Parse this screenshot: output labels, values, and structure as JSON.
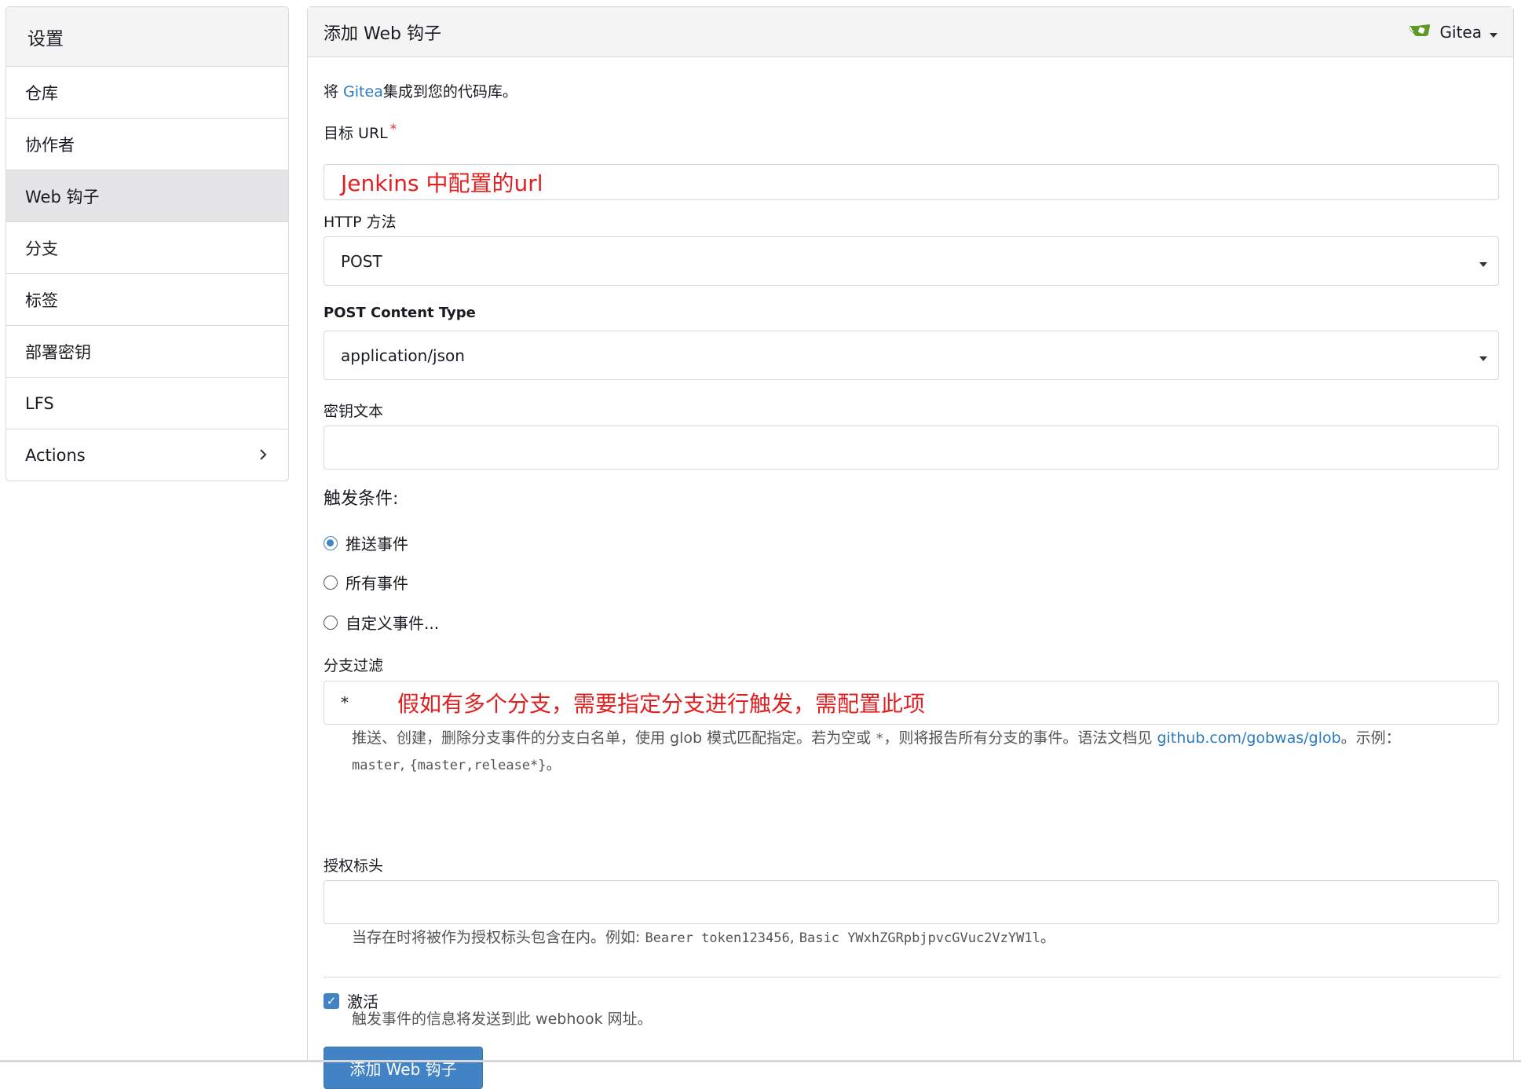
{
  "sidebar": {
    "header": "设置",
    "items": [
      {
        "label": "仓库"
      },
      {
        "label": "协作者"
      },
      {
        "label": "Web 钩子"
      },
      {
        "label": "分支"
      },
      {
        "label": "标签"
      },
      {
        "label": "部署密钥"
      },
      {
        "label": "LFS"
      },
      {
        "label": "Actions"
      }
    ],
    "active_item": "Web 钩子"
  },
  "panel": {
    "title": "添加 Web 钩子",
    "type_menu": {
      "label": "Gitea",
      "icon": "gitea-logo-icon"
    }
  },
  "intro": {
    "before": "将 ",
    "link": "Gitea",
    "after": "集成到您的代码库。"
  },
  "target_url": {
    "label": "目标 URL",
    "required_mark": "*",
    "value": "",
    "annotation": "Jenkins 中配置的url"
  },
  "http_method": {
    "label": "HTTP 方法",
    "value": "POST"
  },
  "content_type": {
    "label": "POST Content Type",
    "value": "application/json"
  },
  "secret": {
    "label": "密钥文本",
    "value": ""
  },
  "trigger": {
    "label": "触发条件:",
    "options": [
      {
        "label": "推送事件",
        "selected": true
      },
      {
        "label": "所有事件",
        "selected": false
      },
      {
        "label": "自定义事件...",
        "selected": false
      }
    ]
  },
  "branch_filter": {
    "label": "分支过滤",
    "value": "*",
    "annotation": "假如有多个分支，需要指定分支进行触发，需配置此项",
    "help_text": "推送、创建，删除分支事件的分支白名单，使用 glob 模式匹配指定。若为空或 ",
    "help_star": "*",
    "help_text2": "，则将报告所有分支的事件。语法文档见 ",
    "help_link": "github.com/gobwas/glob",
    "help_text3": "。示例：",
    "help_example1": "master",
    "help_sep": ", ",
    "help_example2": "{master,release*}",
    "help_end": "。"
  },
  "auth_header": {
    "label": "授权标头",
    "value": "",
    "help_text": "当存在时将被作为授权标头包含在内。例如: ",
    "help_example1": "Bearer token123456",
    "help_sep": ", ",
    "help_example2": "Basic YWxhZGRpbjpvcGVuc2VzYW1l",
    "help_end": "。"
  },
  "active": {
    "label": "激活",
    "checked": true,
    "help": "触发事件的信息将发送到此 webhook 网址。"
  },
  "submit_button": "添加 Web 钩子",
  "colors": {
    "accent": "#4183c4",
    "annotation": "#e02020",
    "gitea_green": "#609926"
  }
}
